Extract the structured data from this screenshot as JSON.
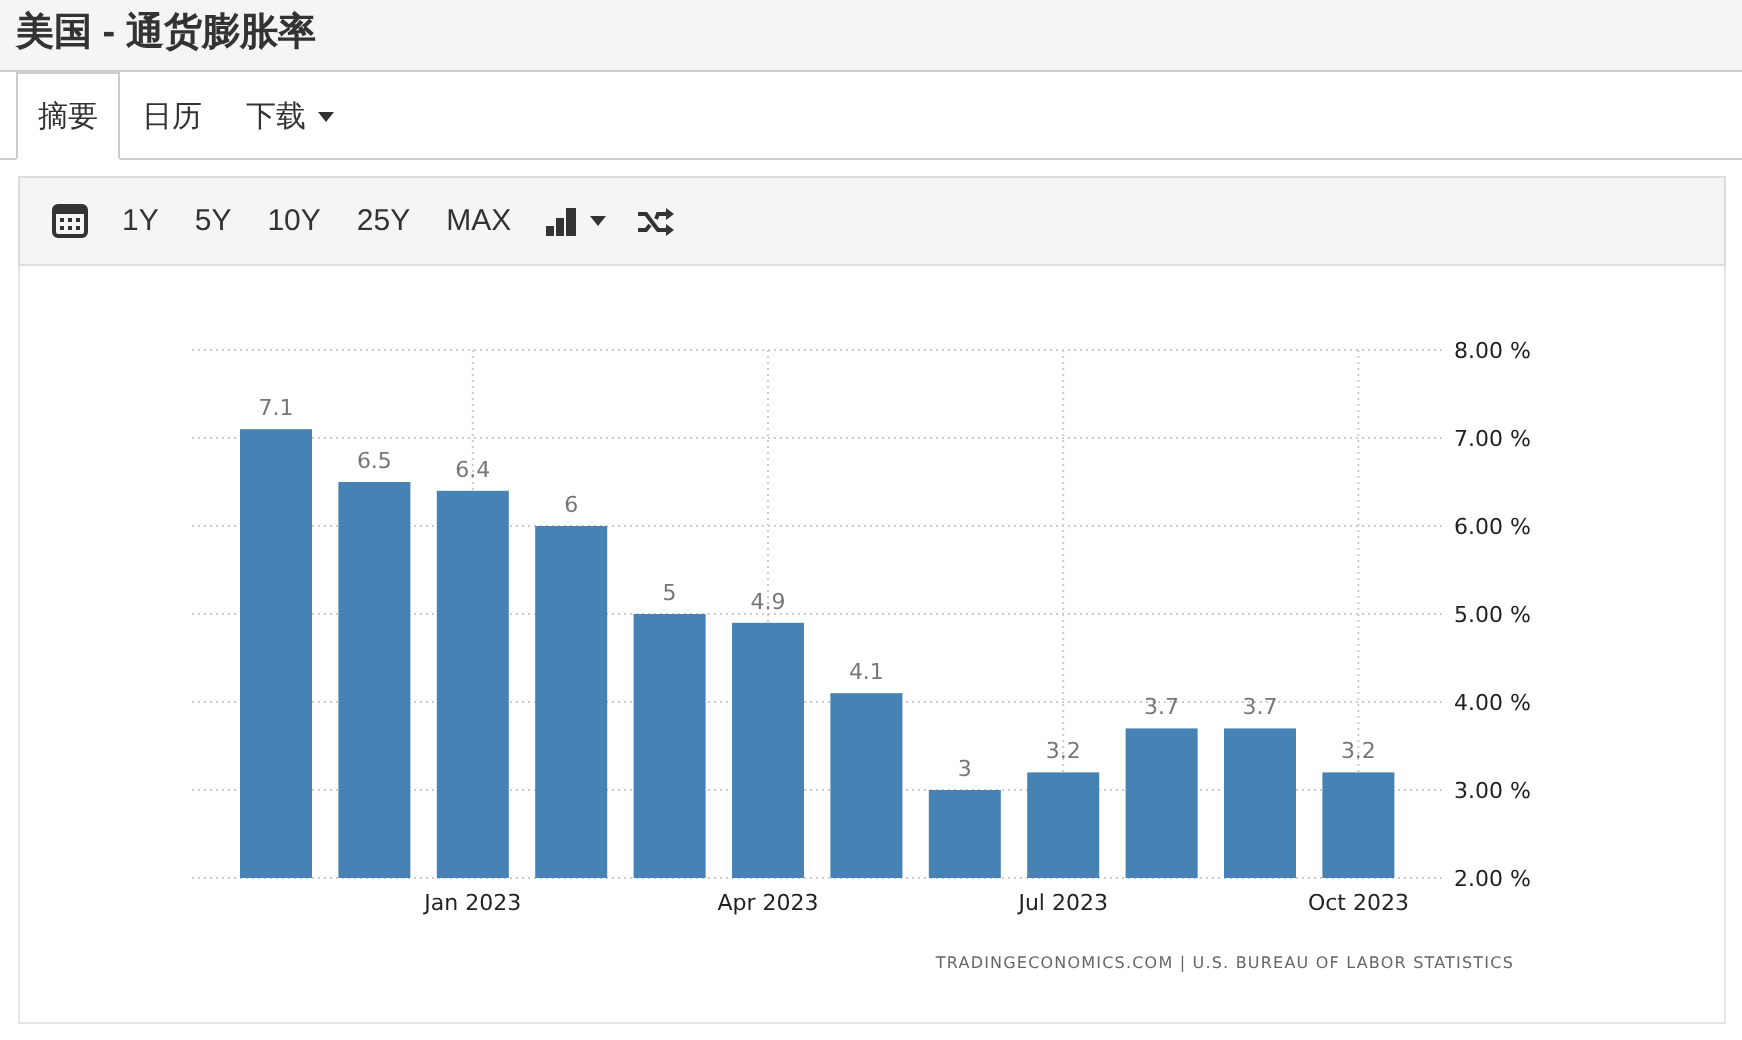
{
  "page_title": "美国 - 通货膨胀率",
  "tabs": [
    {
      "label": "摘要",
      "selected": true,
      "dropdown": false
    },
    {
      "label": "日历",
      "selected": false,
      "dropdown": false
    },
    {
      "label": "下载",
      "selected": false,
      "dropdown": true
    }
  ],
  "toolbar": {
    "ranges": [
      "1Y",
      "5Y",
      "10Y",
      "25Y",
      "MAX"
    ]
  },
  "chart": {
    "chart_data": {
      "type": "bar",
      "categories": [
        null,
        null,
        "Jan 2023",
        null,
        null,
        "Apr 2023",
        null,
        null,
        "Jul 2023",
        null,
        null,
        "Oct 2023"
      ],
      "values": [
        7.1,
        6.5,
        6.4,
        6,
        5,
        4.9,
        4.1,
        3,
        3.2,
        3.7,
        3.7,
        3.2
      ],
      "ylim": [
        2,
        8
      ],
      "yticks": [
        {
          "value": 8,
          "label": "8.00 %"
        },
        {
          "value": 7,
          "label": "7.00 %"
        },
        {
          "value": 6,
          "label": "6.00 %"
        },
        {
          "value": 5,
          "label": "5.00 %"
        },
        {
          "value": 4,
          "label": "4.00 %"
        },
        {
          "value": 3,
          "label": "3.00 %"
        },
        {
          "value": 2,
          "label": "2.00 %"
        }
      ],
      "data_labels": true,
      "grid": true
    },
    "source": "TRADINGECONOMICS.COM | U.S. BUREAU OF LABOR STATISTICS"
  }
}
